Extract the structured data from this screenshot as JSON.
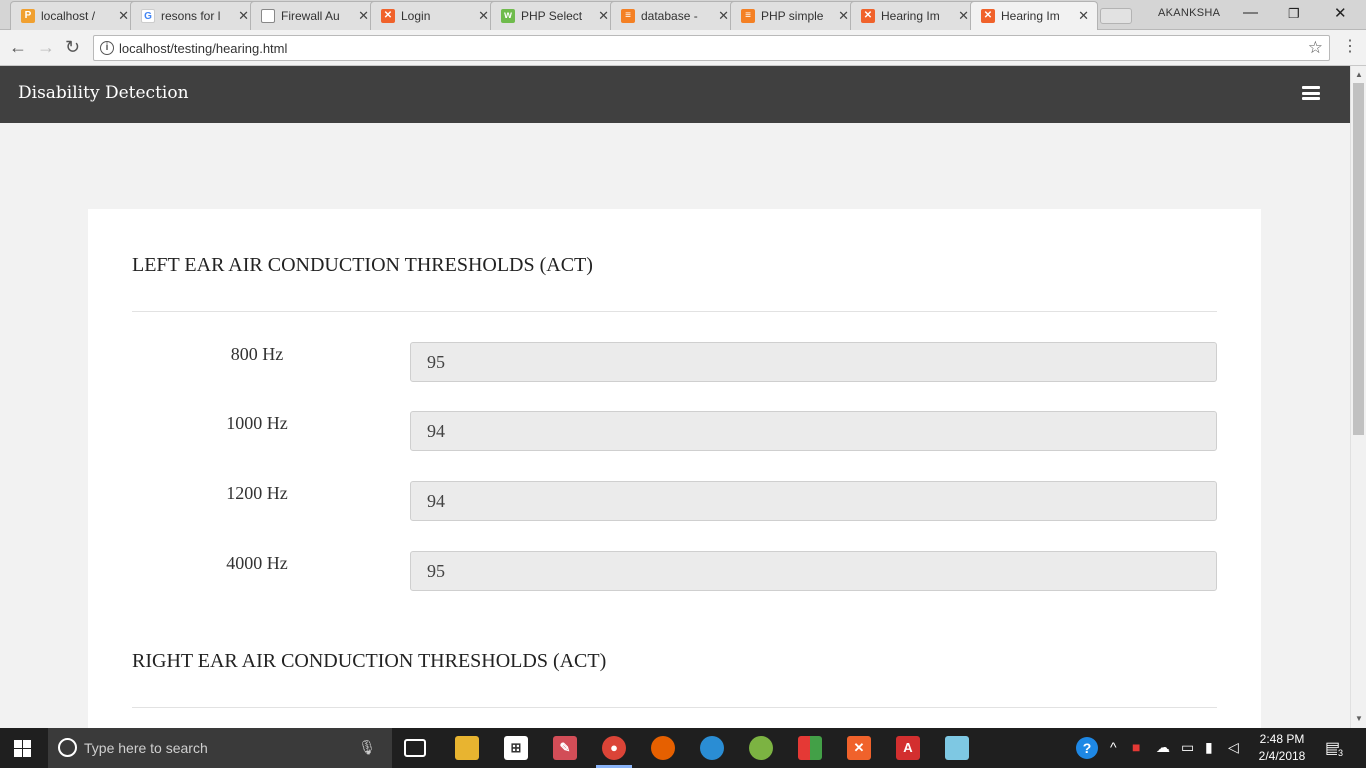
{
  "browser": {
    "tabs": [
      {
        "title": "localhost /",
        "favicon": "phpmyadmin-icon",
        "color": "#f0a030"
      },
      {
        "title": "resons for l",
        "favicon": "google-icon",
        "color": "#4285f4"
      },
      {
        "title": "Firewall Au",
        "favicon": "document-icon",
        "color": "#888888"
      },
      {
        "title": "Login",
        "favicon": "xampp-icon",
        "color": "#f0622b"
      },
      {
        "title": "PHP Select",
        "favicon": "w3schools-icon",
        "color": "#6fbb4c"
      },
      {
        "title": "database -",
        "favicon": "stackoverflow-icon",
        "color": "#f48024"
      },
      {
        "title": "PHP simple",
        "favicon": "stackoverflow-icon",
        "color": "#f48024"
      },
      {
        "title": "Hearing Im",
        "favicon": "xampp-icon",
        "color": "#f0622b"
      },
      {
        "title": "Hearing Im",
        "favicon": "xampp-icon",
        "color": "#f0622b"
      }
    ],
    "profile": "AKANKSHA",
    "url": "localhost/testing/hearing.html"
  },
  "navbar": {
    "brand": "Disability Detection"
  },
  "left_ear": {
    "title": "LEFT EAR AIR CONDUCTION THRESHOLDS (ACT)",
    "rows": [
      {
        "label": "800 Hz",
        "value": "95"
      },
      {
        "label": "1000 Hz",
        "value": "94"
      },
      {
        "label": "1200 Hz",
        "value": "94"
      },
      {
        "label": "4000 Hz",
        "value": "95"
      }
    ]
  },
  "right_ear": {
    "title": "RIGHT EAR AIR CONDUCTION THRESHOLDS (ACT)"
  },
  "taskbar": {
    "search_placeholder": "Type here to search",
    "time": "2:48 PM",
    "date": "2/4/2018",
    "notification_count": "3"
  }
}
